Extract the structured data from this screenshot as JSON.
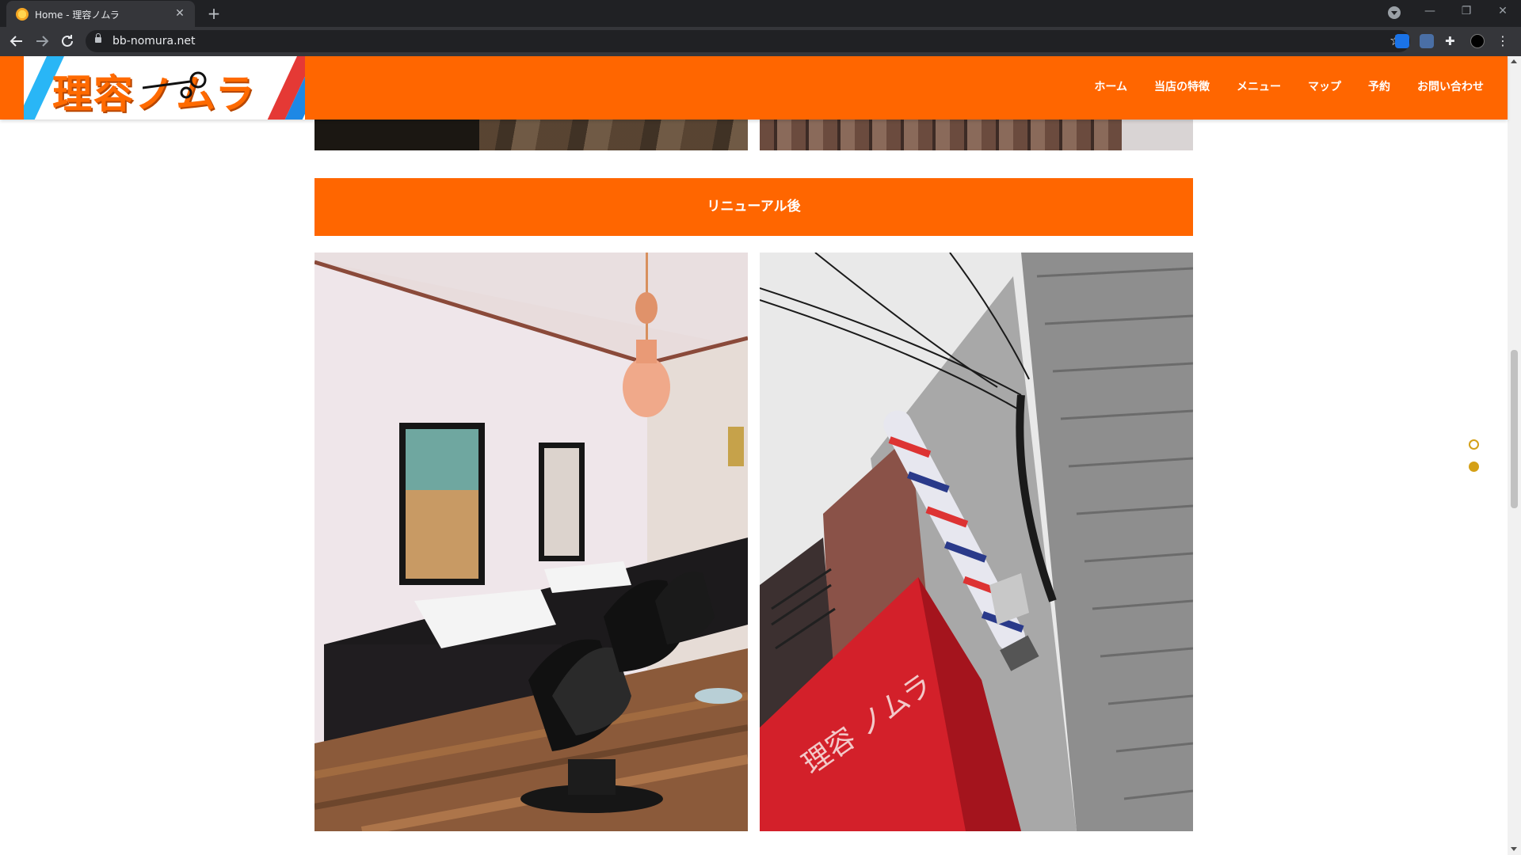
{
  "browser": {
    "tab_title": "Home - 理容ノムラ",
    "tab_close": "✕",
    "new_tab": "+",
    "url": "bb-nomura.net",
    "window_controls": [
      "—",
      "❐",
      "✕"
    ]
  },
  "header": {
    "logo_text": "理容ノムラ",
    "nav": [
      "ホーム",
      "当店の特徴",
      "メニュー",
      "マップ",
      "予約",
      "お問い合わせ"
    ]
  },
  "section": {
    "title": "リニューアル後",
    "sign_text": "理容 ノムラ"
  },
  "colors": {
    "brand": "#ff6600",
    "accent_dot": "#d4a017"
  },
  "slider": {
    "dot_count": 2,
    "active_index": 1
  }
}
